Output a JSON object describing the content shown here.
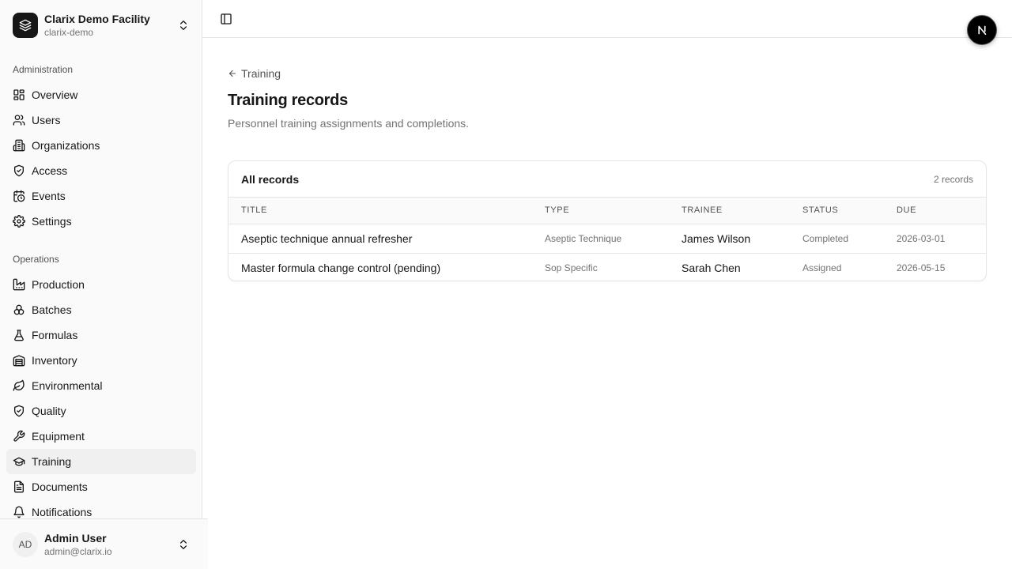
{
  "org": {
    "name": "Clarix Demo Facility",
    "slug": "clarix-demo"
  },
  "sidebar": {
    "groups": [
      {
        "label": "Administration",
        "items": [
          {
            "label": "Overview",
            "icon": "dashboard-icon"
          },
          {
            "label": "Users",
            "icon": "users-icon"
          },
          {
            "label": "Organizations",
            "icon": "building-icon"
          },
          {
            "label": "Access",
            "icon": "shield-check-icon"
          },
          {
            "label": "Events",
            "icon": "calendar-clock-icon"
          },
          {
            "label": "Settings",
            "icon": "gear-icon"
          }
        ]
      },
      {
        "label": "Operations",
        "items": [
          {
            "label": "Production",
            "icon": "factory-icon"
          },
          {
            "label": "Batches",
            "icon": "boxes-icon"
          },
          {
            "label": "Formulas",
            "icon": "flask-icon"
          },
          {
            "label": "Inventory",
            "icon": "warehouse-icon"
          },
          {
            "label": "Environmental",
            "icon": "leaf-icon"
          },
          {
            "label": "Quality",
            "icon": "shield-check-icon"
          },
          {
            "label": "Equipment",
            "icon": "wrench-icon"
          },
          {
            "label": "Training",
            "icon": "graduation-cap-icon",
            "active": true
          },
          {
            "label": "Documents",
            "icon": "document-icon"
          },
          {
            "label": "Notifications",
            "icon": "bell-icon"
          }
        ]
      }
    ]
  },
  "user": {
    "initials": "AD",
    "name": "Admin User",
    "email": "admin@clarix.io"
  },
  "header": {
    "next_badge": "N"
  },
  "page": {
    "back_label": "Training",
    "title": "Training records",
    "subtitle": "Personnel training assignments and completions."
  },
  "card": {
    "title": "All records",
    "count": "2 records",
    "columns": [
      "TITLE",
      "TYPE",
      "TRAINEE",
      "STATUS",
      "DUE"
    ],
    "rows": [
      {
        "title": "Aseptic technique annual refresher",
        "type": "Aseptic Technique",
        "trainee": "James Wilson",
        "status": "Completed",
        "due": "2026-03-01"
      },
      {
        "title": "Master formula change control (pending)",
        "type": "Sop Specific",
        "trainee": "Sarah Chen",
        "status": "Assigned",
        "due": "2026-05-15"
      }
    ]
  },
  "colors": {
    "text": "#171717",
    "muted": "#737373",
    "border": "#e5e5e5",
    "sidebar_bg": "#fafafa",
    "active_bg": "#f0f0f0"
  }
}
